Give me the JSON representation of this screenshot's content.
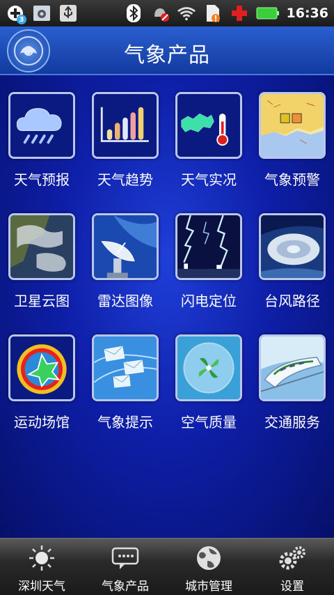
{
  "status_bar": {
    "notification_count": "3",
    "time": "16:36"
  },
  "header": {
    "title": "气象产品"
  },
  "grid": [
    {
      "label": "天气预报",
      "icon": "rain-cloud-icon"
    },
    {
      "label": "天气趋势",
      "icon": "bar-chart-icon"
    },
    {
      "label": "天气实况",
      "icon": "thermometer-map-icon"
    },
    {
      "label": "气象预警",
      "icon": "warning-map-icon"
    },
    {
      "label": "卫星云图",
      "icon": "satellite-image-icon"
    },
    {
      "label": "雷达图像",
      "icon": "radar-dish-icon"
    },
    {
      "label": "闪电定位",
      "icon": "lightning-icon"
    },
    {
      "label": "台风路径",
      "icon": "typhoon-icon"
    },
    {
      "label": "运动场馆",
      "icon": "stadium-icon"
    },
    {
      "label": "气象提示",
      "icon": "envelope-icon"
    },
    {
      "label": "空气质量",
      "icon": "pinwheel-bubble-icon"
    },
    {
      "label": "交通服务",
      "icon": "train-icon"
    }
  ],
  "tabs": [
    {
      "label": "深圳天气",
      "icon": "sun-icon"
    },
    {
      "label": "气象产品",
      "icon": "message-icon"
    },
    {
      "label": "城市管理",
      "icon": "globe-icon"
    },
    {
      "label": "设置",
      "icon": "gears-icon"
    }
  ],
  "colors": {
    "background": "#0e1fa8",
    "header": "#2a5fd0",
    "tile_border": "#b8c6f0"
  }
}
